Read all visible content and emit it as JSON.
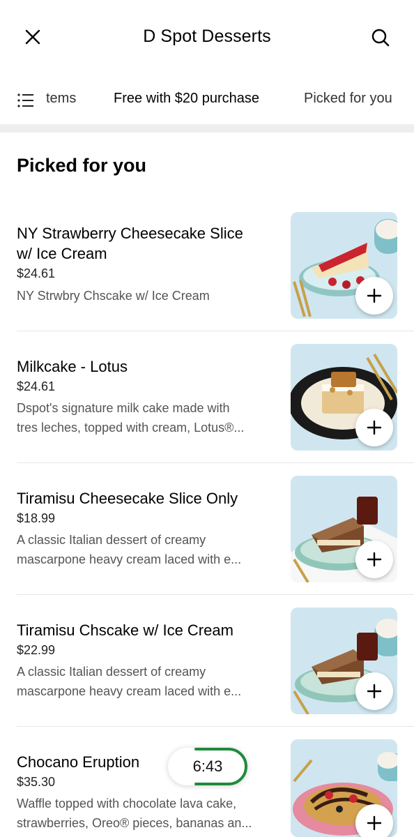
{
  "header": {
    "title": "D Spot Desserts",
    "close_icon": "close-icon",
    "search_icon": "search-icon"
  },
  "tabs": {
    "menu_icon": "list-icon",
    "items": [
      {
        "label": "tems"
      },
      {
        "label": "Free with $20 purchase",
        "active": true
      },
      {
        "label": "Picked for you"
      }
    ]
  },
  "section": {
    "title": "Picked for you"
  },
  "menu_items": [
    {
      "name_line1": "NY Strawberry Cheesecake Slice",
      "name_line2": "w/ Ice Cream",
      "price": "$24.61",
      "desc_line1": "NY Strwbry Chscake w/ Ice Cream",
      "desc_line2": ""
    },
    {
      "name_line1": "Milkcake - Lotus",
      "name_line2": "",
      "price": "$24.61",
      "desc_line1": "Dspot's signature milk cake made with",
      "desc_line2": "tres leches, topped with cream, Lotus®..."
    },
    {
      "name_line1": "Tiramisu Cheesecake Slice Only",
      "name_line2": "",
      "price": "$18.99",
      "desc_line1": "A classic Italian dessert of creamy",
      "desc_line2": "mascarpone heavy cream laced with e..."
    },
    {
      "name_line1": "Tiramisu Chscake w/ Ice Cream",
      "name_line2": "",
      "price": "$22.99",
      "desc_line1": "A classic Italian dessert of creamy",
      "desc_line2": "mascarpone heavy cream laced with e..."
    },
    {
      "name_line1": "Chocano Eruption",
      "name_line2": "",
      "price": "$35.30",
      "desc_line1": "Waffle topped with chocolate lava cake,",
      "desc_line2": "strawberries, Oreo® pieces, bananas an..."
    }
  ],
  "add_icon": "plus-icon",
  "timer": {
    "text": "6:43",
    "accent": "#1f8a3c"
  },
  "colors": {
    "accent_text": "#000000",
    "muted_text": "#545454",
    "thumb_bg": "#cfe6f0"
  }
}
